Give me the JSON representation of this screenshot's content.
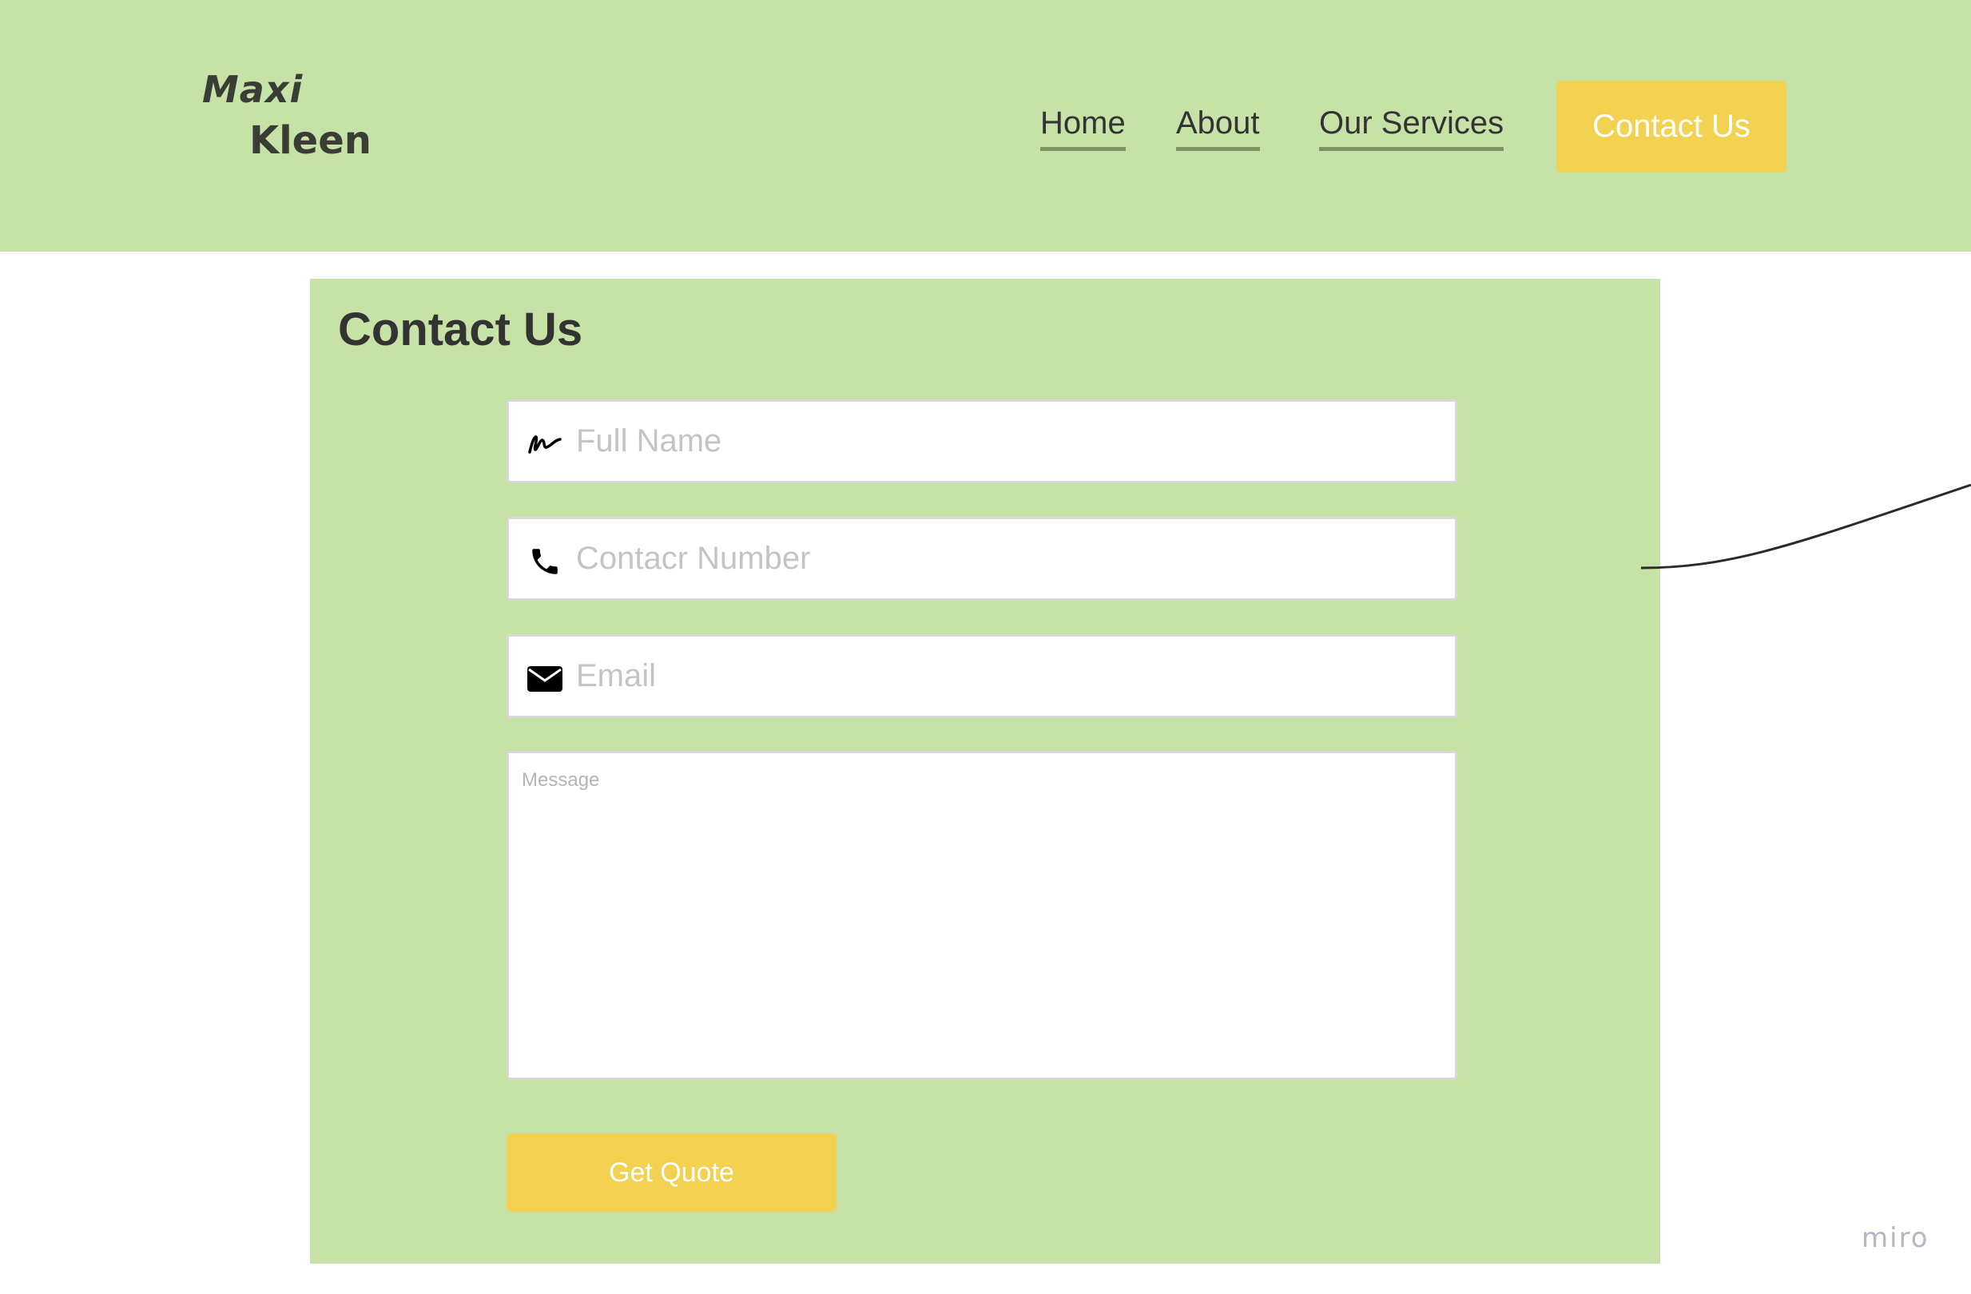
{
  "header": {
    "logo_line1": "Maxi",
    "logo_line2": "Kleen",
    "nav": {
      "home": "Home",
      "about": "About",
      "services": "Our Services"
    },
    "cta_label": "Contact Us"
  },
  "contact": {
    "title": "Contact Us",
    "full_name_placeholder": "Full Name",
    "contact_number_placeholder": "Contacr Number",
    "email_placeholder": "Email",
    "message_placeholder": "Message",
    "submit_label": "Get Quote"
  },
  "icons": {
    "full_name": "signature-icon",
    "contact_number": "phone-icon",
    "email": "envelope-icon"
  },
  "colors": {
    "brand_green": "#c6e2a6",
    "accent_yellow": "#f2d250",
    "text_dark": "#333333"
  },
  "watermark": "miro"
}
